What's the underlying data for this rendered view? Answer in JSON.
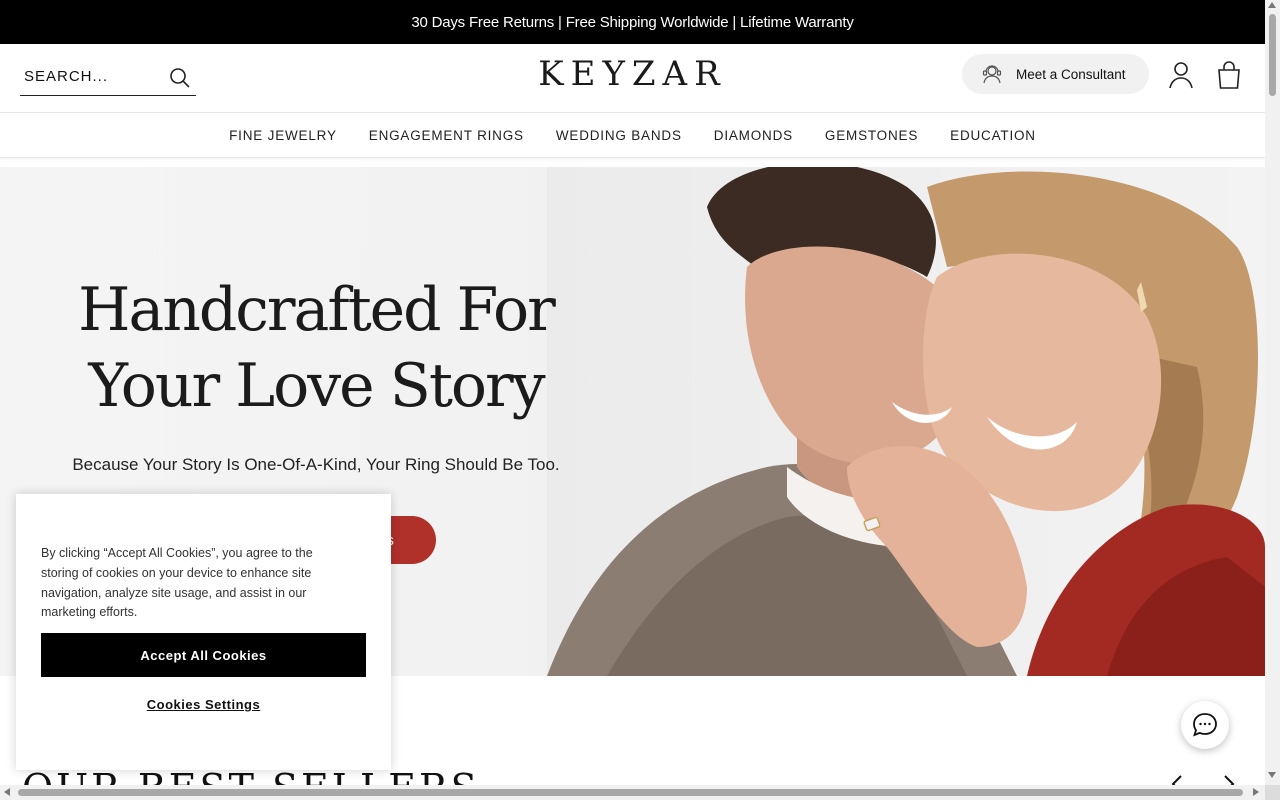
{
  "announcement": {
    "text": "30 Days Free Returns | Free Shipping Worldwide | Lifetime Warranty"
  },
  "header": {
    "search_placeholder": "SEARCH...",
    "logo": "KEYZAR",
    "consultant_label": "Meet a Consultant",
    "icons": [
      "search-icon",
      "consultant-icon",
      "user-icon",
      "bag-icon"
    ]
  },
  "nav": {
    "items": [
      {
        "label": "FINE JEWELRY"
      },
      {
        "label": "ENGAGEMENT RINGS"
      },
      {
        "label": "WEDDING BANDS"
      },
      {
        "label": "DIAMONDS"
      },
      {
        "label": "GEMSTONES"
      },
      {
        "label": "EDUCATION"
      }
    ]
  },
  "hero": {
    "title_line1": "Handcrafted For",
    "title_line2": "Your Love Story",
    "subtitle": "Because Your Story Is One-Of-A-Kind, Your Ring Should Be Too.",
    "cta_label": "gs"
  },
  "best_sellers": {
    "title": "OUR BEST SELLERS"
  },
  "cookie_banner": {
    "text": "By clicking “Accept All Cookies”, you agree to the storing of cookies on your device to enhance site navigation, analyze site usage, and assist in our marketing efforts.",
    "accept_label": "Accept All Cookies",
    "settings_label": "Cookies Settings"
  },
  "colors": {
    "announcement_bg": "#000000",
    "cta": "#b0302a",
    "consult_bg": "#f1f1f1"
  }
}
